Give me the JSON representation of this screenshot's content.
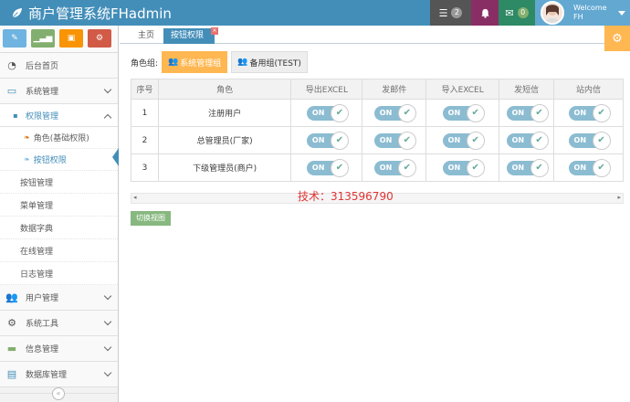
{
  "navbar": {
    "title": "商户管理系统FHadmin",
    "messages_count": "2",
    "notifications_count": "",
    "mail_count": "0",
    "welcome": "Welcome",
    "username": "FH"
  },
  "sidebar": {
    "items": [
      {
        "label": "后台首页",
        "icon": "tachometer-icon"
      },
      {
        "label": "系统管理",
        "icon": "desktop-icon"
      },
      {
        "label": "权限管理",
        "icon": "lock-icon"
      },
      {
        "label": "角色(基础权限)"
      },
      {
        "label": "按钮权限"
      },
      {
        "label": "按钮管理"
      },
      {
        "label": "菜单管理"
      },
      {
        "label": "数据字典"
      },
      {
        "label": "在线管理"
      },
      {
        "label": "日志管理"
      },
      {
        "label": "用户管理",
        "icon": "users-icon"
      },
      {
        "label": "系统工具",
        "icon": "cog-icon"
      },
      {
        "label": "信息管理",
        "icon": "credit-card-icon"
      },
      {
        "label": "数据库管理",
        "icon": "hdd-icon"
      }
    ]
  },
  "tabs": [
    {
      "label": "主页"
    },
    {
      "label": "按钮权限"
    }
  ],
  "role_group": {
    "label": "角色组:",
    "buttons": [
      "系统管理组",
      "备用组(TEST)"
    ]
  },
  "table": {
    "headers": [
      "序号",
      "角色",
      "导出EXCEL",
      "发邮件",
      "导入EXCEL",
      "发短信",
      "站内信"
    ],
    "rows": [
      {
        "no": "1",
        "role": "注册用户"
      },
      {
        "no": "2",
        "role": "总管理员(厂家)"
      },
      {
        "no": "3",
        "role": "下级管理员(商户)"
      }
    ],
    "toggle_label": "ON"
  },
  "support_text": "技术：313596790",
  "switch_view_label": "切换视图",
  "colors": {
    "navbar": "#438eb9",
    "accent_orange": "#ffb752",
    "toggle_on": "#8bbcd1",
    "switch_btn": "#87b87f"
  }
}
